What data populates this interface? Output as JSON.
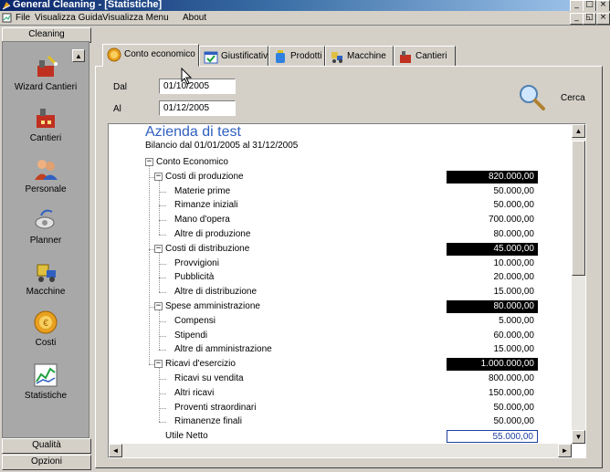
{
  "window": {
    "title": "General Cleaning - [Statistiche]"
  },
  "menu": [
    "File",
    "Visualizza Guida",
    "Visualizza Menu",
    "About"
  ],
  "sidebar": {
    "top_header": "Cleaning",
    "items": [
      {
        "label": "Wizard Cantieri",
        "icon": "wizard-icon"
      },
      {
        "label": "Cantieri",
        "icon": "building-icon"
      },
      {
        "label": "Personale",
        "icon": "people-icon"
      },
      {
        "label": "Planner",
        "icon": "satellite-icon"
      },
      {
        "label": "Macchine",
        "icon": "machine-icon"
      },
      {
        "label": "Costi",
        "icon": "coin-icon"
      },
      {
        "label": "Statistiche",
        "icon": "chart-icon"
      }
    ],
    "bottom_headers": [
      "Qualità",
      "Opzioni"
    ]
  },
  "tabs": [
    {
      "label": "Conto economico",
      "active": true
    },
    {
      "label": "Giustificativi"
    },
    {
      "label": "Prodotti"
    },
    {
      "label": "Macchine"
    },
    {
      "label": "Cantieri"
    }
  ],
  "filters": {
    "dal_label": "Dal",
    "dal_value": "01/10/2005",
    "al_label": "Al",
    "al_value": "01/12/2005",
    "search_button": "Cerca"
  },
  "report": {
    "company": "Azienda di test",
    "period": "Bilancio dal 01/01/2005 al 31/12/2005",
    "root": "Conto Economico",
    "sections": [
      {
        "name": "Costi di produzione",
        "total": "820.000,00",
        "items": [
          {
            "name": "Materie prime",
            "value": "50.000,00"
          },
          {
            "name": "Rimanze iniziali",
            "value": "50.000,00"
          },
          {
            "name": "Mano d'opera",
            "value": "700.000,00"
          },
          {
            "name": "Altre di produzione",
            "value": "80.000,00"
          }
        ]
      },
      {
        "name": "Costi di distribuzione",
        "total": "45.000,00",
        "items": [
          {
            "name": "Provvigioni",
            "value": "10.000,00"
          },
          {
            "name": "Pubblicità",
            "value": "20.000,00"
          },
          {
            "name": "Altre di distribuzione",
            "value": "15.000,00"
          }
        ]
      },
      {
        "name": "Spese amministrazione",
        "total": "80.000,00",
        "items": [
          {
            "name": "Compensi",
            "value": "5.000,00"
          },
          {
            "name": "Stipendi",
            "value": "60.000,00"
          },
          {
            "name": "Altre di amministrazione",
            "value": "15.000,00"
          }
        ]
      },
      {
        "name": "Ricavi d'esercizio",
        "total": "1.000.000,00",
        "items": [
          {
            "name": "Ricavi su vendita",
            "value": "800.000,00"
          },
          {
            "name": "Altri ricavi",
            "value": "150.000,00"
          },
          {
            "name": "Proventi straordinari",
            "value": "50.000,00"
          },
          {
            "name": "Rimanenze finali",
            "value": "50.000,00"
          }
        ]
      }
    ],
    "net_label": "Utile Netto",
    "net_value": "55.000,00"
  },
  "colors": {
    "company_title": "#3060c0",
    "highlight_bg": "#000000",
    "net_border": "#2040a0"
  }
}
